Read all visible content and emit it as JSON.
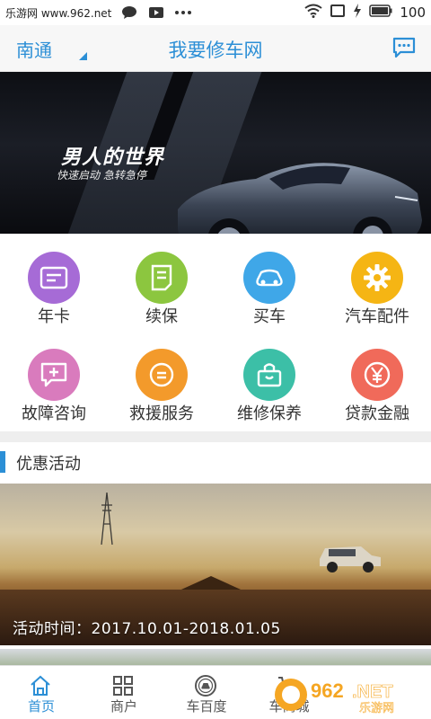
{
  "status_bar": {
    "site_label": "乐游网 www.962.net",
    "battery": "100"
  },
  "header": {
    "city": "南通",
    "title": "我要修车网"
  },
  "banner": {
    "headline": "男人的世界",
    "subline": "快速启动 急转急停",
    "dot_count": 5,
    "active_dot": 0
  },
  "grid": {
    "items": [
      {
        "label": "年卡",
        "icon": "card-icon",
        "color": "#a66bd6"
      },
      {
        "label": "续保",
        "icon": "document-icon",
        "color": "#8cc63f"
      },
      {
        "label": "买车",
        "icon": "car-icon",
        "color": "#3fa7e8"
      },
      {
        "label": "汽车配件",
        "icon": "gear-icon",
        "color": "#f5b514"
      },
      {
        "label": "故障咨询",
        "icon": "chat-plus-icon",
        "color": "#d97bbd"
      },
      {
        "label": "救援服务",
        "icon": "rescue-icon",
        "color": "#f39a2b"
      },
      {
        "label": "维修保养",
        "icon": "bag-icon",
        "color": "#3cbfa7"
      },
      {
        "label": "贷款金融",
        "icon": "yen-icon",
        "color": "#f06a5a"
      }
    ]
  },
  "promotions": {
    "section_title": "优惠活动",
    "items": [
      {
        "date_text": "活动时间：2017.10.01-2018.01.05"
      }
    ]
  },
  "tab_bar": {
    "tabs": [
      {
        "label": "首页",
        "icon": "home-icon",
        "active": true
      },
      {
        "label": "商户",
        "icon": "grid-icon",
        "active": false
      },
      {
        "label": "车百度",
        "icon": "car-badge-icon",
        "active": false
      },
      {
        "label": "车商城",
        "icon": "cart-icon",
        "active": false
      }
    ]
  },
  "watermark": {
    "text": "962.NET",
    "sub": "乐游网"
  },
  "colors": {
    "accent": "#2c8fd6"
  }
}
